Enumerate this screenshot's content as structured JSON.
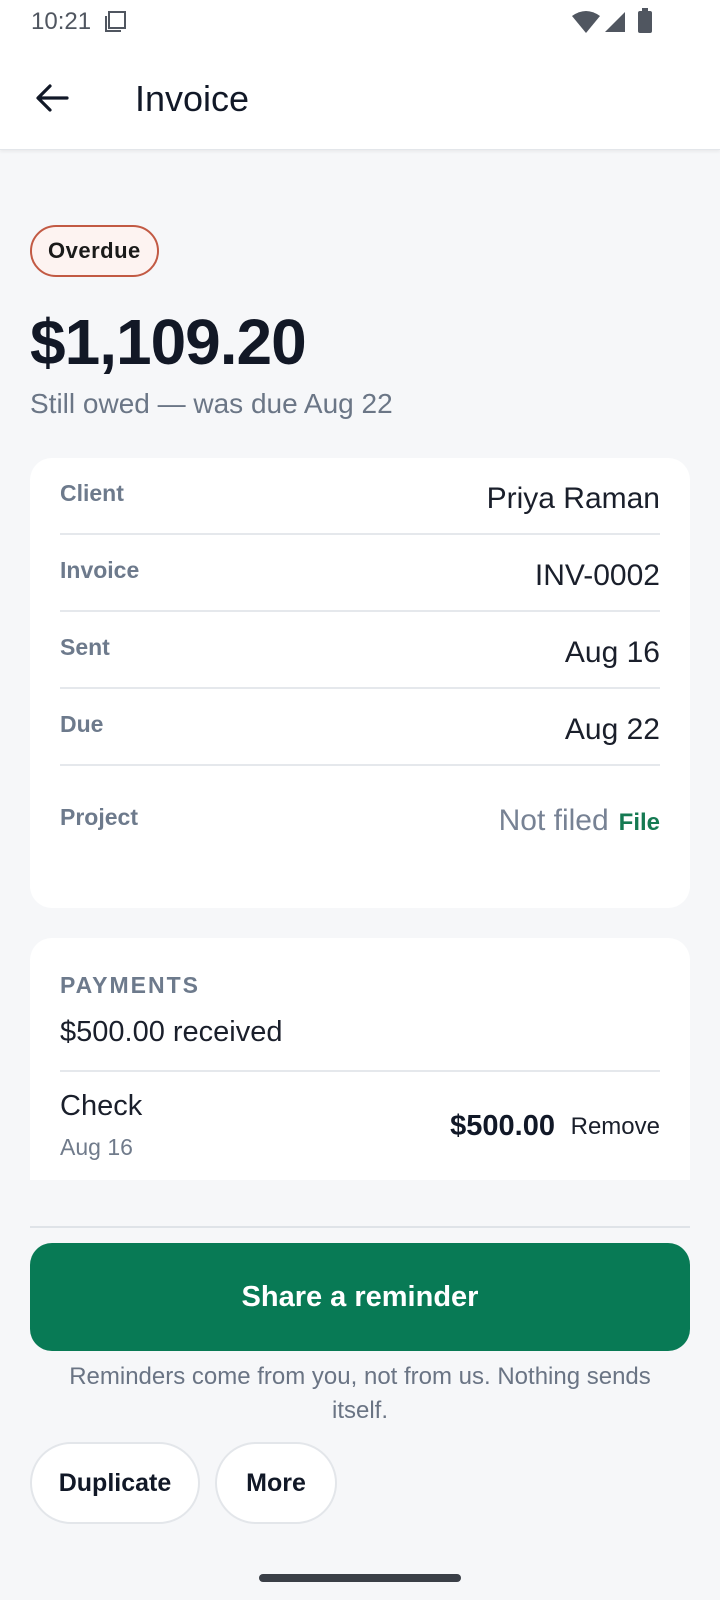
{
  "status_bar": {
    "time": "10:21"
  },
  "app_bar": {
    "title": "Invoice"
  },
  "invoice": {
    "status": "Overdue",
    "amount": "$1,109.20",
    "subtitle": "Still owed — was due Aug 22"
  },
  "details": {
    "rows": [
      {
        "label": "Client",
        "value": "Priya Raman"
      },
      {
        "label": "Invoice",
        "value": "INV-0002"
      },
      {
        "label": "Sent",
        "value": "Aug 16"
      },
      {
        "label": "Due",
        "value": "Aug 22"
      }
    ],
    "project": {
      "label": "Project",
      "value": "Not filed",
      "action": "File"
    }
  },
  "payments": {
    "heading": "PAYMENTS",
    "total": "$500.00 received",
    "items": [
      {
        "method": "Check",
        "date": "Aug 16",
        "amount": "$500.00",
        "action": "Remove"
      }
    ]
  },
  "actions": {
    "primary": "Share a reminder",
    "note": "Reminders come from you, not from us. Nothing sends itself.",
    "duplicate": "Duplicate",
    "more": "More"
  },
  "colors": {
    "accent": "#087a55",
    "overdue_border": "#c25a44",
    "link": "#157a52"
  }
}
